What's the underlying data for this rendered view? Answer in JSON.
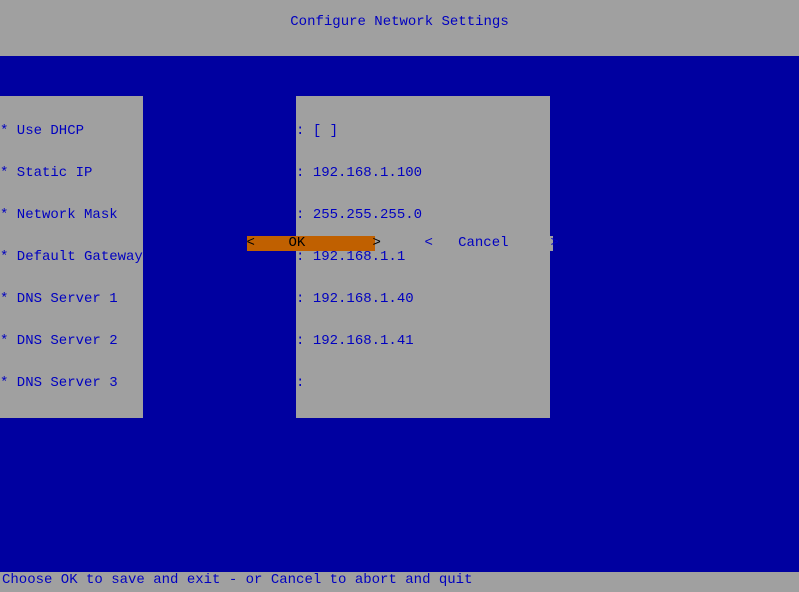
{
  "title": "Configure Network Settings",
  "fields": [
    {
      "label": "* Use DHCP",
      "value": "[ ]"
    },
    {
      "label": "* Static IP",
      "value": "192.168.1.100"
    },
    {
      "label": "* Network Mask",
      "value": "255.255.255.0"
    },
    {
      "label": "* Default Gateway",
      "value": "192.168.1.1"
    },
    {
      "label": "* DNS Server 1",
      "value": "192.168.1.40"
    },
    {
      "label": "* DNS Server 2",
      "value": "192.168.1.41"
    },
    {
      "label": "* DNS Server 3",
      "value": ""
    }
  ],
  "buttons": {
    "ok": "<    OK        >",
    "cancel": "<   Cancel     >"
  },
  "footer": "Choose OK to save and exit - or Cancel to abort and quit"
}
